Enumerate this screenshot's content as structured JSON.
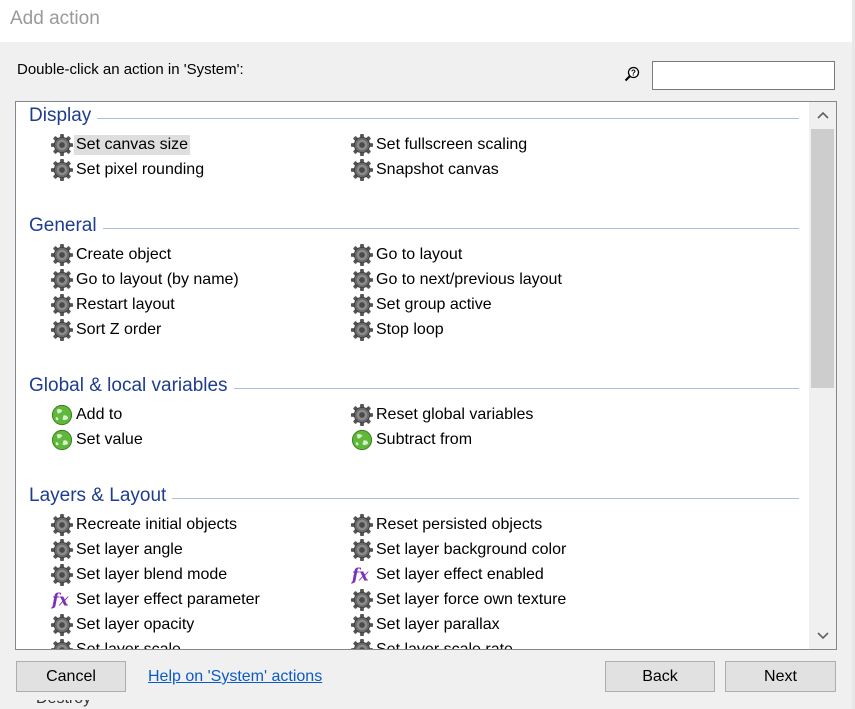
{
  "window": {
    "title": "Add action"
  },
  "instruction": "Double-click an action in 'System':",
  "search": {
    "value": "",
    "placeholder": "",
    "icon": "search-help-icon"
  },
  "categories": [
    {
      "name": "Display",
      "actions": [
        {
          "label": "Set canvas size",
          "icon": "gear-icon",
          "selected": true
        },
        {
          "label": "Set fullscreen scaling",
          "icon": "gear-icon"
        },
        {
          "label": "Set pixel rounding",
          "icon": "gear-icon"
        },
        {
          "label": "Snapshot canvas",
          "icon": "gear-icon"
        }
      ]
    },
    {
      "name": "General",
      "actions": [
        {
          "label": "Create object",
          "icon": "gear-icon"
        },
        {
          "label": "Go to layout",
          "icon": "gear-icon"
        },
        {
          "label": "Go to layout (by name)",
          "icon": "gear-icon"
        },
        {
          "label": "Go to next/previous layout",
          "icon": "gear-icon"
        },
        {
          "label": "Restart layout",
          "icon": "gear-icon"
        },
        {
          "label": "Set group active",
          "icon": "gear-icon"
        },
        {
          "label": "Sort Z order",
          "icon": "gear-icon"
        },
        {
          "label": "Stop loop",
          "icon": "gear-icon"
        }
      ]
    },
    {
      "name": "Global & local variables",
      "actions": [
        {
          "label": "Add to",
          "icon": "globe-icon"
        },
        {
          "label": "Reset global variables",
          "icon": "gear-icon"
        },
        {
          "label": "Set value",
          "icon": "globe-icon"
        },
        {
          "label": "Subtract from",
          "icon": "globe-icon"
        }
      ]
    },
    {
      "name": "Layers & Layout",
      "actions": [
        {
          "label": "Recreate initial objects",
          "icon": "gear-icon"
        },
        {
          "label": "Reset persisted objects",
          "icon": "gear-icon"
        },
        {
          "label": "Set layer angle",
          "icon": "gear-icon"
        },
        {
          "label": "Set layer background color",
          "icon": "gear-icon"
        },
        {
          "label": "Set layer blend mode",
          "icon": "gear-icon"
        },
        {
          "label": "Set layer effect enabled",
          "icon": "fx-icon"
        },
        {
          "label": "Set layer effect parameter",
          "icon": "fx-icon"
        },
        {
          "label": "Set layer force own texture",
          "icon": "gear-icon"
        },
        {
          "label": "Set layer opacity",
          "icon": "gear-icon"
        },
        {
          "label": "Set layer parallax",
          "icon": "gear-icon"
        },
        {
          "label": "Set layer scale",
          "icon": "gear-icon"
        },
        {
          "label": "Set layer scale rate",
          "icon": "gear-icon"
        }
      ]
    }
  ],
  "buttons": {
    "cancel": "Cancel",
    "back": "Back",
    "next": "Next"
  },
  "help_link": "Help on 'System' actions",
  "background_text": "Destroy",
  "colors": {
    "category": "#1e3d8f",
    "link": "#0b5bc7",
    "selection": "#dedede",
    "fx": "#7b2fb5"
  }
}
